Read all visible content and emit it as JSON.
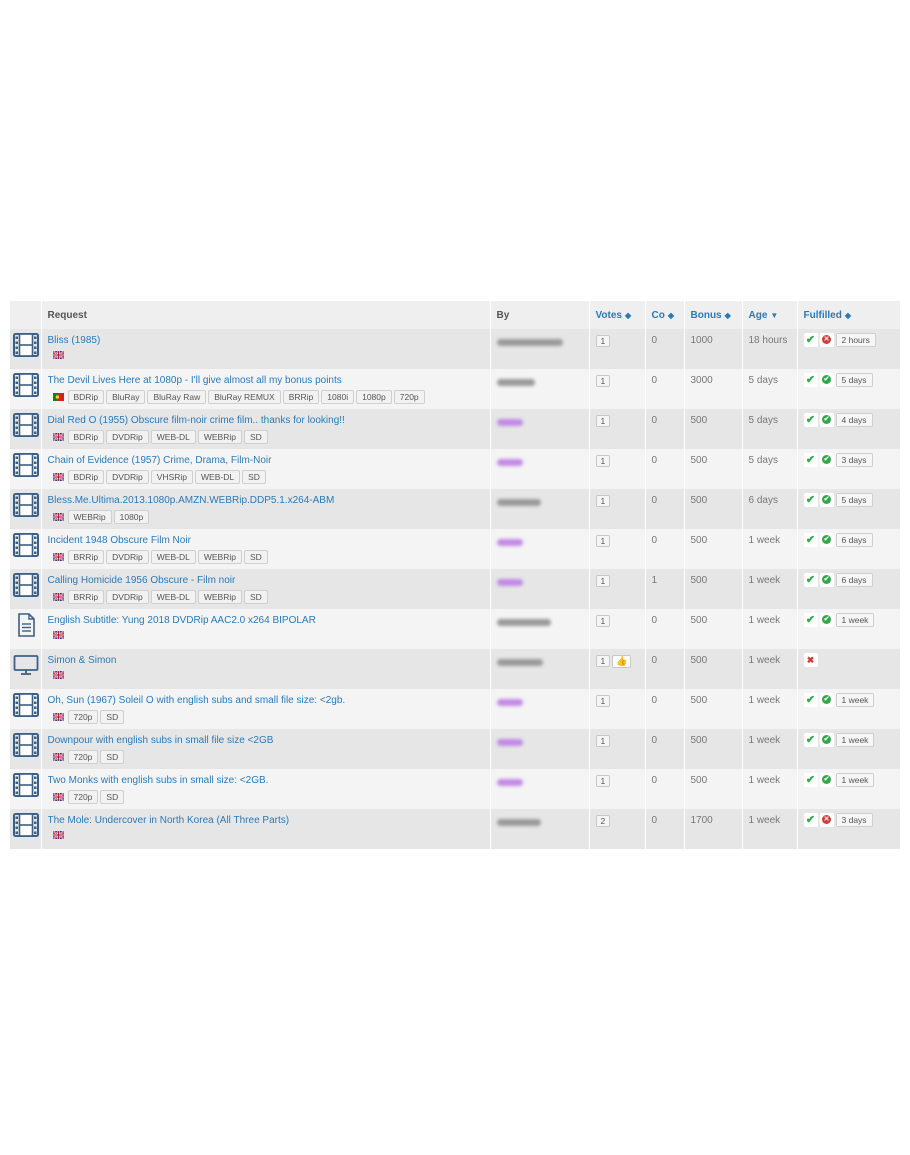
{
  "table": {
    "headers": {
      "request": "Request",
      "by": "By",
      "votes": "Votes",
      "comments": "Co",
      "bonus": "Bonus",
      "age": "Age",
      "fulfilled": "Fulfilled"
    },
    "rows": [
      {
        "icon": "film-icon",
        "title": "Bliss (1985)",
        "flag": "uk-flag-icon",
        "tags": [],
        "user_color": "grey",
        "user_width": 66,
        "votes": "1",
        "thumb": false,
        "comments": "0",
        "bonus": "1000",
        "age": "18 hours",
        "status": [
          "check",
          "red"
        ],
        "fulfilled_age": "2 hours"
      },
      {
        "icon": "film-icon",
        "title": "The Devil Lives Here at 1080p - I'll give almost all my bonus points",
        "flag": "portugal-flag-icon",
        "tags": [
          "BDRip",
          "BluRay",
          "BluRay Raw",
          "BluRay REMUX",
          "BRRip",
          "1080i",
          "1080p",
          "720p"
        ],
        "user_color": "grey",
        "user_width": 38,
        "votes": "1",
        "thumb": false,
        "comments": "0",
        "bonus": "3000",
        "age": "5 days",
        "status": [
          "check",
          "green"
        ],
        "fulfilled_age": "5 days"
      },
      {
        "icon": "film-icon",
        "title": "Dial Red O (1955) Obscure film-noir crime film.. thanks for looking!!",
        "flag": "uk-flag-icon",
        "tags": [
          "BDRip",
          "DVDRip",
          "WEB-DL",
          "WEBRip",
          "SD"
        ],
        "user_color": "purple",
        "user_width": 26,
        "votes": "1",
        "thumb": false,
        "comments": "0",
        "bonus": "500",
        "age": "5 days",
        "status": [
          "check",
          "green"
        ],
        "fulfilled_age": "4 days"
      },
      {
        "icon": "film-icon",
        "title": "Chain of Evidence (1957) Crime, Drama, Film-Noir",
        "flag": "uk-flag-icon",
        "tags": [
          "BDRip",
          "DVDRip",
          "VHSRip",
          "WEB-DL",
          "SD"
        ],
        "user_color": "purple",
        "user_width": 26,
        "votes": "1",
        "thumb": false,
        "comments": "0",
        "bonus": "500",
        "age": "5 days",
        "status": [
          "check",
          "green"
        ],
        "fulfilled_age": "3 days"
      },
      {
        "icon": "film-icon",
        "title": "Bless.Me.Ultima.2013.1080p.AMZN.WEBRip.DDP5.1.x264-ABM",
        "flag": "uk-flag-icon",
        "tags": [
          "WEBRip",
          "1080p"
        ],
        "user_color": "grey",
        "user_width": 44,
        "votes": "1",
        "thumb": false,
        "comments": "0",
        "bonus": "500",
        "age": "6 days",
        "status": [
          "check",
          "green"
        ],
        "fulfilled_age": "5 days"
      },
      {
        "icon": "film-icon",
        "title": "Incident 1948 Obscure Film Noir",
        "flag": "uk-flag-icon",
        "tags": [
          "BRRip",
          "DVDRip",
          "WEB-DL",
          "WEBRip",
          "SD"
        ],
        "user_color": "purple",
        "user_width": 26,
        "votes": "1",
        "thumb": false,
        "comments": "0",
        "bonus": "500",
        "age": "1 week",
        "status": [
          "check",
          "green"
        ],
        "fulfilled_age": "6 days"
      },
      {
        "icon": "film-icon",
        "title": "Calling Homicide 1956 Obscure - Film noir",
        "flag": "uk-flag-icon",
        "tags": [
          "BRRip",
          "DVDRip",
          "WEB-DL",
          "WEBRip",
          "SD"
        ],
        "user_color": "purple",
        "user_width": 26,
        "votes": "1",
        "thumb": false,
        "comments": "1",
        "bonus": "500",
        "age": "1 week",
        "status": [
          "check",
          "green"
        ],
        "fulfilled_age": "6 days"
      },
      {
        "icon": "document-icon",
        "title": "English Subtitle: Yung 2018 DVDRip AAC2.0 x264 BIPOLAR",
        "flag": "uk-flag-icon",
        "tags": [],
        "user_color": "grey",
        "user_width": 54,
        "votes": "1",
        "thumb": false,
        "comments": "0",
        "bonus": "500",
        "age": "1 week",
        "status": [
          "check",
          "green"
        ],
        "fulfilled_age": "1 week"
      },
      {
        "icon": "tv-icon",
        "title": "Simon & Simon",
        "flag": "uk-flag-icon",
        "tags": [],
        "user_color": "grey",
        "user_width": 46,
        "votes": "1",
        "thumb": true,
        "comments": "0",
        "bonus": "500",
        "age": "1 week",
        "status": [
          "x"
        ],
        "fulfilled_age": ""
      },
      {
        "icon": "film-icon",
        "title": "Oh, Sun (1967) Soleil Ô with english subs and small file size: <2gb.",
        "flag": "uk-flag-icon",
        "tags": [
          "720p",
          "SD"
        ],
        "user_color": "purple",
        "user_width": 26,
        "votes": "1",
        "thumb": false,
        "comments": "0",
        "bonus": "500",
        "age": "1 week",
        "status": [
          "check",
          "green"
        ],
        "fulfilled_age": "1 week"
      },
      {
        "icon": "film-icon",
        "title": "Downpour with english subs in small file size <2GB",
        "flag": "uk-flag-icon",
        "tags": [
          "720p",
          "SD"
        ],
        "user_color": "purple",
        "user_width": 26,
        "votes": "1",
        "thumb": false,
        "comments": "0",
        "bonus": "500",
        "age": "1 week",
        "status": [
          "check",
          "green"
        ],
        "fulfilled_age": "1 week"
      },
      {
        "icon": "film-icon",
        "title": "Two Monks with english subs in small size: <2GB.",
        "flag": "uk-flag-icon",
        "tags": [
          "720p",
          "SD"
        ],
        "user_color": "purple",
        "user_width": 26,
        "votes": "1",
        "thumb": false,
        "comments": "0",
        "bonus": "500",
        "age": "1 week",
        "status": [
          "check",
          "green"
        ],
        "fulfilled_age": "1 week"
      },
      {
        "icon": "film-icon",
        "title": "The Mole: Undercover in North Korea (All Three Parts)",
        "flag": "uk-flag-icon",
        "tags": [],
        "user_color": "grey",
        "user_width": 44,
        "votes": "2",
        "thumb": false,
        "comments": "0",
        "bonus": "1700",
        "age": "1 week",
        "status": [
          "check",
          "red"
        ],
        "fulfilled_age": "3 days"
      }
    ]
  }
}
